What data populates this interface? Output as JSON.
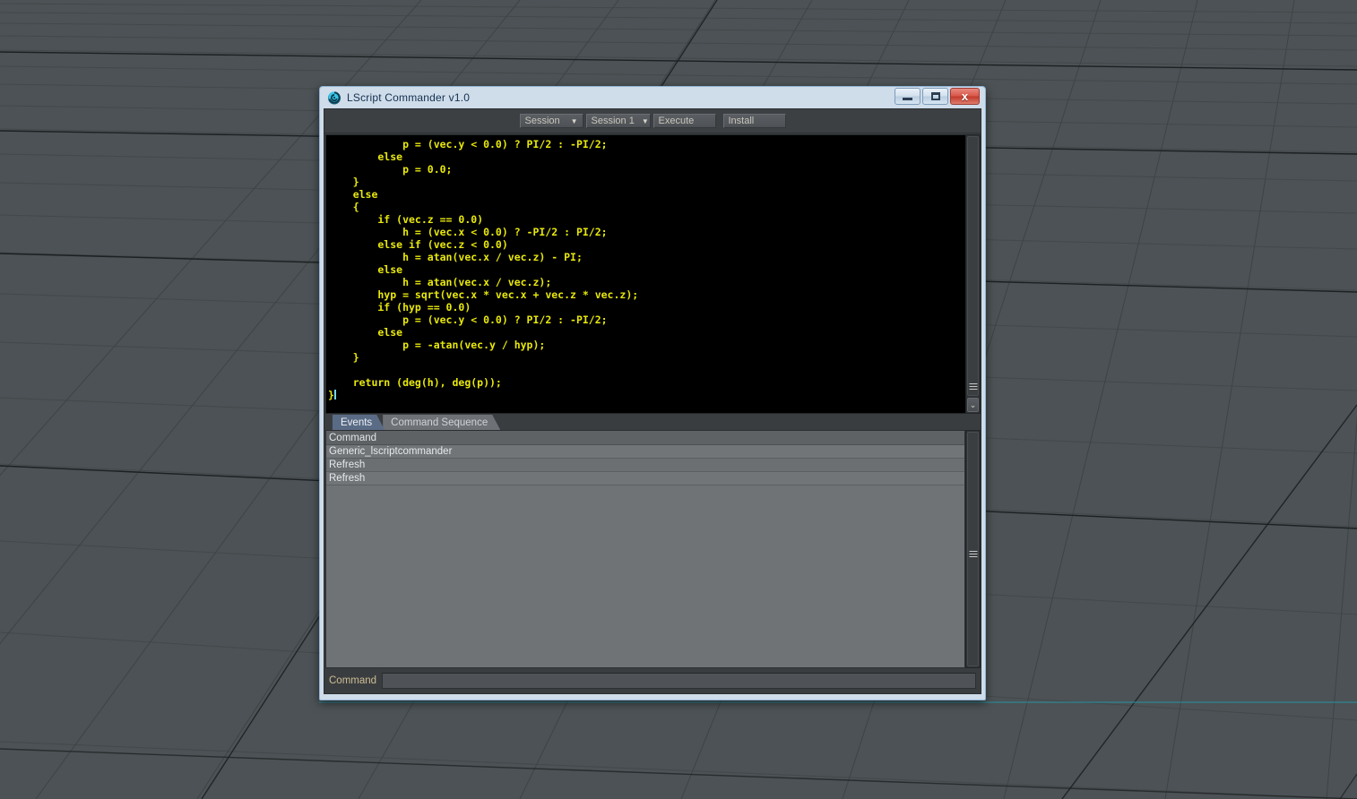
{
  "window": {
    "title": "LScript Commander v1.0",
    "icon": "lightwave-spiral-icon",
    "minimize_label": "",
    "maximize_label": "",
    "close_label": "x",
    "frame_color": "#cfdcea",
    "client_color": "#3a3d40"
  },
  "toolbar": {
    "session_select": "Session",
    "session_instance_select": "Session 1",
    "execute_label": "Execute",
    "install_label": "Install",
    "chevron": "❯"
  },
  "editor": {
    "text_color": "#e8e80c",
    "background": "#000000",
    "cursor_visible": true,
    "lines": [
      "            p = (vec.y < 0.0) ? PI/2 : -PI/2;",
      "        else",
      "            p = 0.0;",
      "    }",
      "    else",
      "    {",
      "        if (vec.z == 0.0)",
      "            h = (vec.x < 0.0) ? -PI/2 : PI/2;",
      "        else if (vec.z < 0.0)",
      "            h = atan(vec.x / vec.z) - PI;",
      "        else",
      "            h = atan(vec.x / vec.z);",
      "        hyp = sqrt(vec.x * vec.x + vec.z * vec.z);",
      "        if (hyp == 0.0)",
      "            p = (vec.y < 0.0) ? PI/2 : -PI/2;",
      "        else",
      "            p = -atan(vec.y / hyp);",
      "    }",
      "",
      "    return (deg(h), deg(p));",
      "}"
    ],
    "scroll_down_arrow": "⌄"
  },
  "tabs": [
    {
      "label": "Events",
      "active": true
    },
    {
      "label": "Command Sequence",
      "active": false
    }
  ],
  "event_list": {
    "columns": [
      "Command"
    ],
    "rows": [
      [
        "Generic_lscriptcommander"
      ],
      [
        "Refresh"
      ],
      [
        "Refresh"
      ]
    ]
  },
  "command_bar": {
    "label": "Command",
    "value": "",
    "placeholder": ""
  }
}
